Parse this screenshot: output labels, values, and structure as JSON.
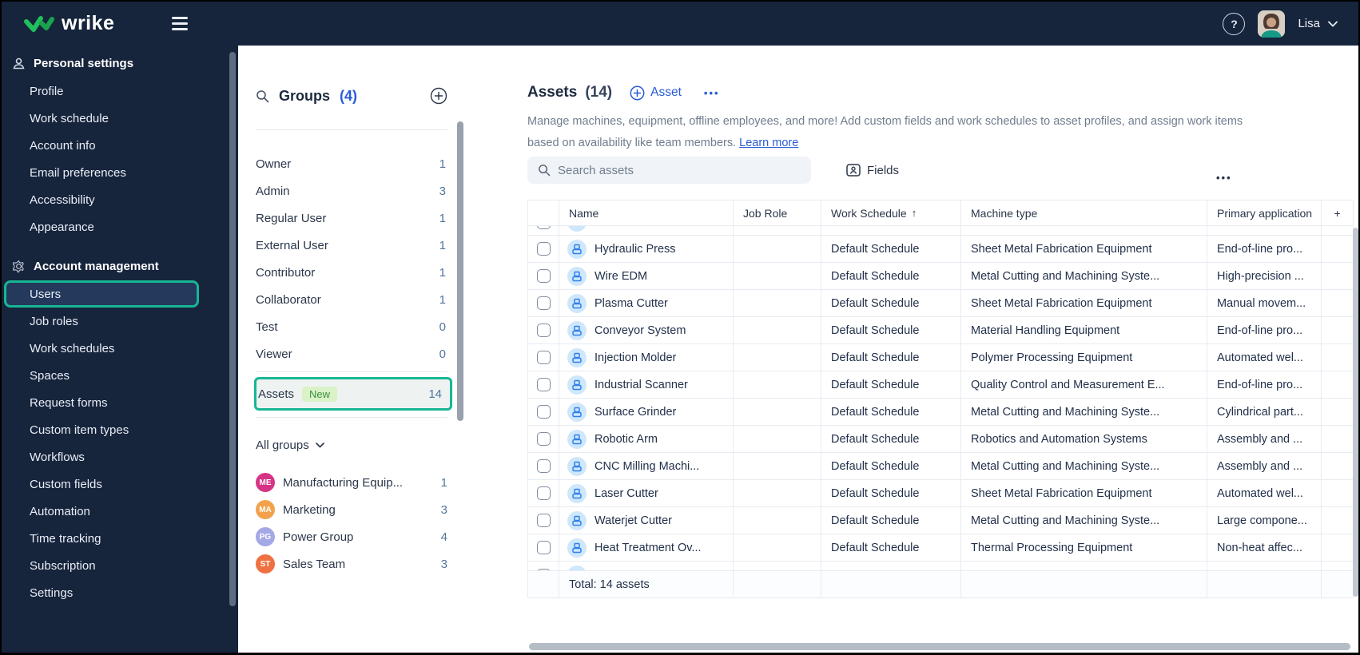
{
  "topbar": {
    "brand": "wrike",
    "user_name": "Lisa"
  },
  "icons": {
    "help": "?",
    "sort_asc": "↑",
    "more": "•••",
    "add_column": "+"
  },
  "sidebar": {
    "personal": {
      "header": "Personal settings",
      "items": [
        "Profile",
        "Work schedule",
        "Account info",
        "Email preferences",
        "Accessibility",
        "Appearance"
      ]
    },
    "account": {
      "header": "Account management",
      "active_item": "Users",
      "items": [
        "Job roles",
        "Work schedules",
        "Spaces",
        "Request forms",
        "Custom item types",
        "Workflows",
        "Custom fields",
        "Automation",
        "Time tracking",
        "Subscription",
        "Settings"
      ]
    }
  },
  "groups_panel": {
    "title": "Groups",
    "count": "(4)",
    "roles": [
      {
        "label": "Owner",
        "count": "1"
      },
      {
        "label": "Admin",
        "count": "3"
      },
      {
        "label": "Regular User",
        "count": "1"
      },
      {
        "label": "External User",
        "count": "1"
      },
      {
        "label": "Contributor",
        "count": "1"
      },
      {
        "label": "Collaborator",
        "count": "1"
      },
      {
        "label": "Test",
        "count": "0"
      },
      {
        "label": "Viewer",
        "count": "0"
      }
    ],
    "assets_row": {
      "label": "Assets",
      "badge": "New",
      "count": "14"
    },
    "all_groups_label": "All groups",
    "groups": [
      {
        "initials": "ME",
        "name": "Manufacturing Equip...",
        "count": "1",
        "color": "#d63384"
      },
      {
        "initials": "MA",
        "name": "Marketing",
        "count": "3",
        "color": "#f2a24c"
      },
      {
        "initials": "PG",
        "name": "Power Group",
        "count": "4",
        "color": "#a5a8e6"
      },
      {
        "initials": "ST",
        "name": "Sales Team",
        "count": "3",
        "color": "#ef7040"
      }
    ]
  },
  "main": {
    "title": "Assets",
    "count": "(14)",
    "add_button": "Asset",
    "description": "Manage machines, equipment, offline employees, and more! Add custom fields and work schedules to asset profiles, and assign work items based on availability like team members.",
    "learn_more": "Learn more",
    "search_placeholder": "Search assets",
    "fields_button": "Fields",
    "table": {
      "columns": [
        "Name",
        "Job Role",
        "Work Schedule",
        "Machine type",
        "Primary application"
      ],
      "sort_column": "Work Schedule",
      "sort_direction": "asc",
      "rows": [
        {
          "name": "Hydraulic Press",
          "job_role": "",
          "work_schedule": "Default Schedule",
          "machine_type": "Sheet Metal Fabrication Equipment",
          "primary_application": "End-of-line pro..."
        },
        {
          "name": "Wire EDM",
          "job_role": "",
          "work_schedule": "Default Schedule",
          "machine_type": "Metal Cutting and Machining Syste...",
          "primary_application": "High-precision ..."
        },
        {
          "name": "Plasma Cutter",
          "job_role": "",
          "work_schedule": "Default Schedule",
          "machine_type": "Sheet Metal Fabrication Equipment",
          "primary_application": "Manual movem..."
        },
        {
          "name": "Conveyor System",
          "job_role": "",
          "work_schedule": "Default Schedule",
          "machine_type": "Material Handling Equipment",
          "primary_application": "End-of-line pro..."
        },
        {
          "name": "Injection Molder",
          "job_role": "",
          "work_schedule": "Default Schedule",
          "machine_type": "Polymer Processing Equipment",
          "primary_application": "Automated wel..."
        },
        {
          "name": "Industrial Scanner",
          "job_role": "",
          "work_schedule": "Default Schedule",
          "machine_type": "Quality Control and Measurement E...",
          "primary_application": "End-of-line pro..."
        },
        {
          "name": "Surface Grinder",
          "job_role": "",
          "work_schedule": "Default Schedule",
          "machine_type": "Metal Cutting and Machining Syste...",
          "primary_application": "Cylindrical part..."
        },
        {
          "name": "Robotic Arm",
          "job_role": "",
          "work_schedule": "Default Schedule",
          "machine_type": "Robotics and Automation Systems",
          "primary_application": "Assembly and ..."
        },
        {
          "name": "CNC Milling Machi...",
          "job_role": "",
          "work_schedule": "Default Schedule",
          "machine_type": "Metal Cutting and Machining Syste...",
          "primary_application": "Assembly and ..."
        },
        {
          "name": "Laser Cutter",
          "job_role": "",
          "work_schedule": "Default Schedule",
          "machine_type": "Sheet Metal Fabrication Equipment",
          "primary_application": "Automated wel..."
        },
        {
          "name": "Waterjet Cutter",
          "job_role": "",
          "work_schedule": "Default Schedule",
          "machine_type": "Metal Cutting and Machining Syste...",
          "primary_application": "Large compone..."
        },
        {
          "name": "Heat Treatment Ov...",
          "job_role": "",
          "work_schedule": "Default Schedule",
          "machine_type": "Thermal Processing Equipment",
          "primary_application": "Non-heat affec..."
        }
      ],
      "total": "Total: 14 assets"
    }
  },
  "colors": {
    "accent_teal": "#17b695",
    "brand_green": "#20c05c",
    "link_blue": "#2a5bd7",
    "topbar_navy": "#16243c"
  }
}
